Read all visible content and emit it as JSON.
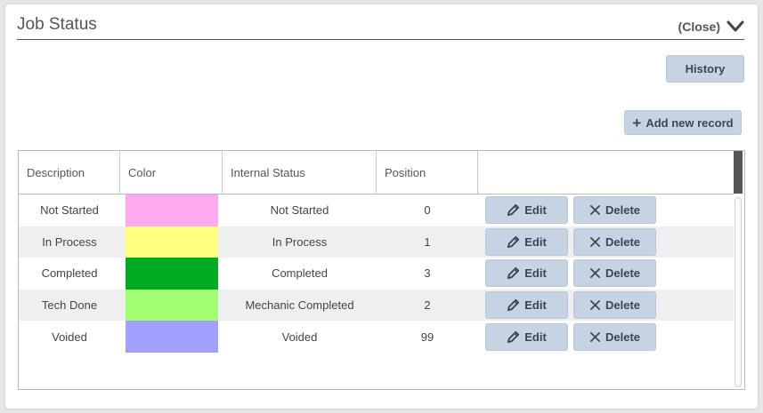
{
  "panel": {
    "title": "Job Status",
    "close_label": "(Close)",
    "history_label": "History",
    "add_label": "Add new record"
  },
  "table": {
    "columns": [
      "Description",
      "Color",
      "Internal Status",
      "Position",
      ""
    ],
    "rows": [
      {
        "description": "Not Started",
        "color": "#ffaaf0",
        "internal_status": "Not Started",
        "position": "0"
      },
      {
        "description": "In Process",
        "color": "#ffff80",
        "internal_status": "In Process",
        "position": "1"
      },
      {
        "description": "Completed",
        "color": "#00aa22",
        "internal_status": "Completed",
        "position": "3"
      },
      {
        "description": "Tech Done",
        "color": "#a4ff74",
        "internal_status": "Mechanic Completed",
        "position": "2"
      },
      {
        "description": "Voided",
        "color": "#a0a0ff",
        "internal_status": "Voided",
        "position": "99"
      }
    ],
    "edit_label": "Edit",
    "delete_label": "Delete"
  },
  "icons": {
    "close": "chevron-down-icon",
    "add": "plus-icon",
    "edit": "pencil-icon",
    "delete": "x-icon"
  },
  "colors": {
    "button_bg": "#c5d3e2",
    "button_text": "#3c4652"
  }
}
